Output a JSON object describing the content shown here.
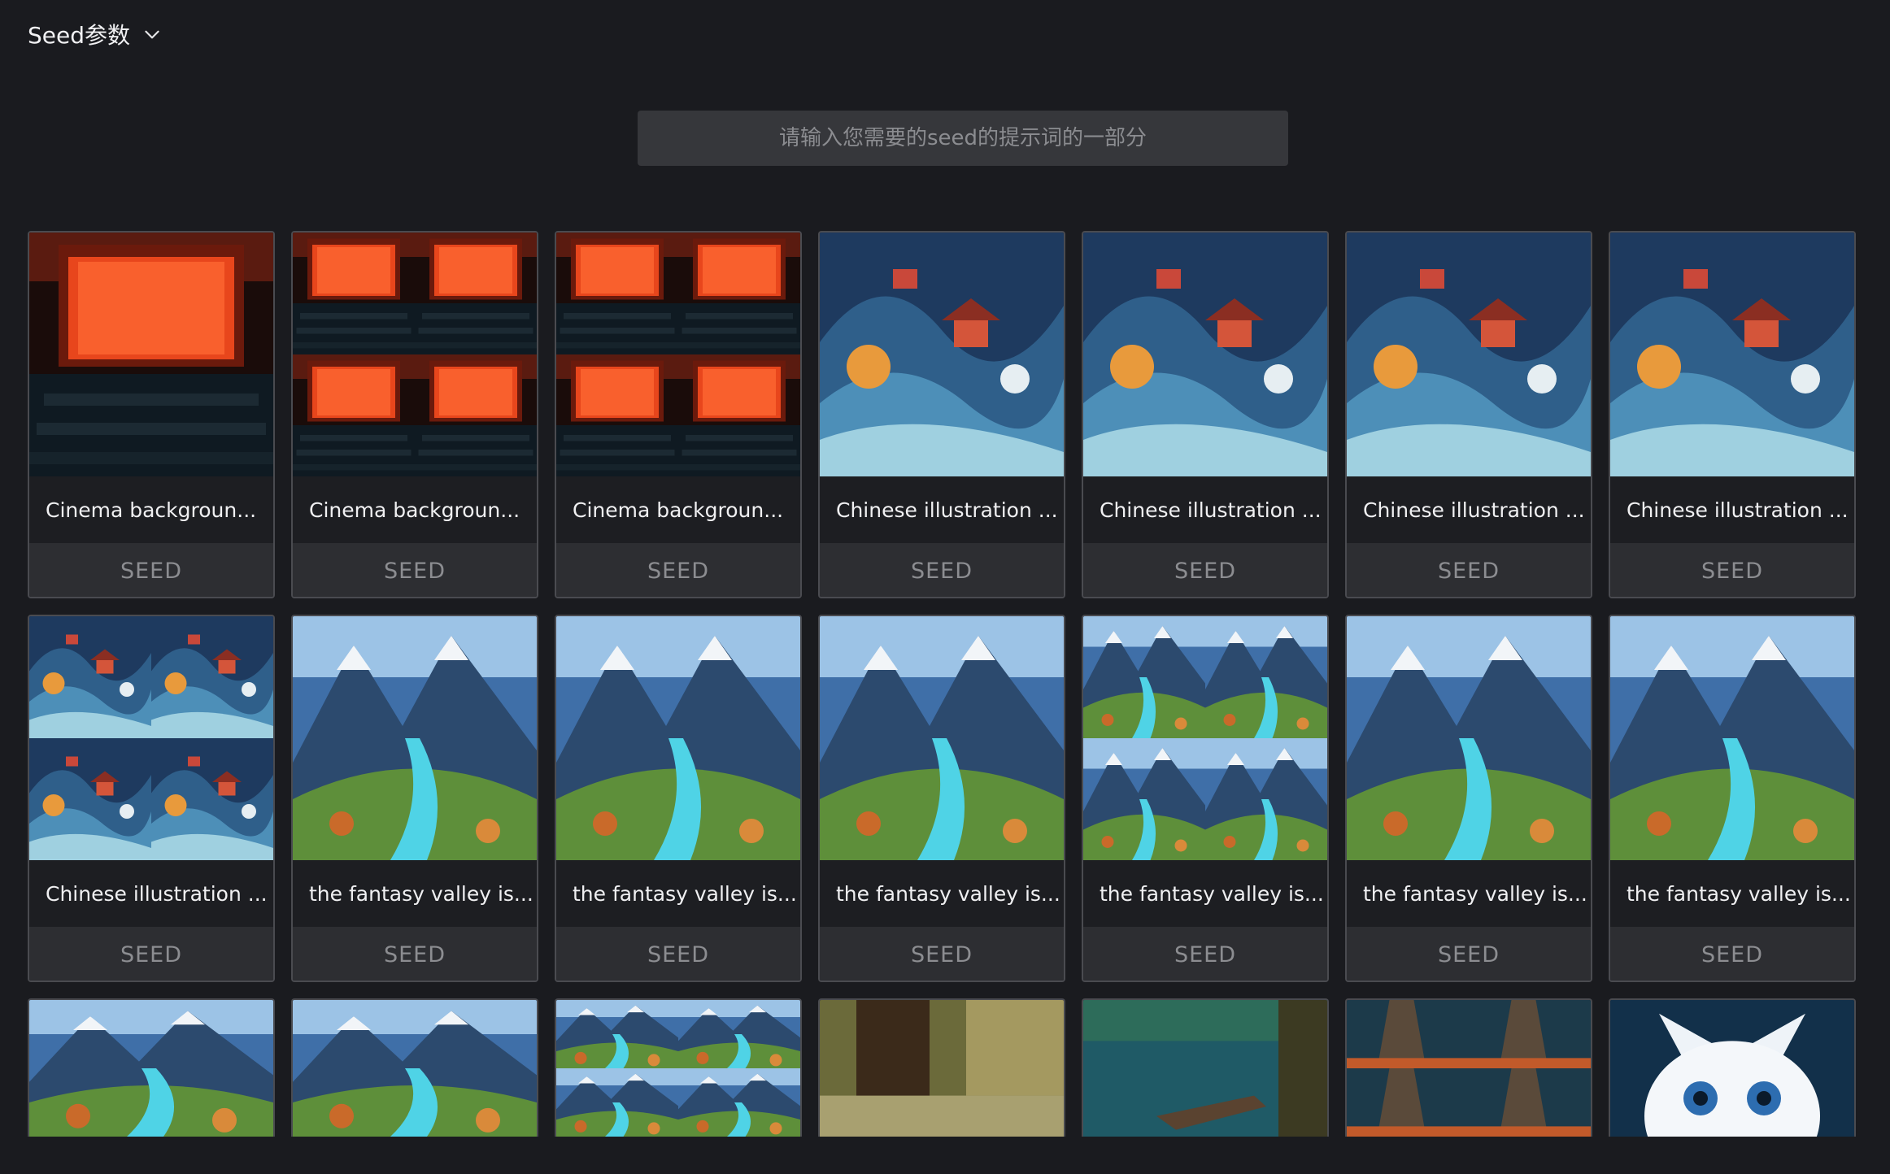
{
  "header": {
    "title": "Seed参数",
    "dropdown_icon": "chevron-down-icon"
  },
  "search": {
    "placeholder": "请输入您需要的seed的提示词的一部分",
    "value": ""
  },
  "seed_button_label": "SEED",
  "cards": [
    {
      "title": "Cinema backgroun...",
      "theme": "cinema",
      "layout": "single"
    },
    {
      "title": "Cinema backgroun...",
      "theme": "cinema",
      "layout": "quad"
    },
    {
      "title": "Cinema backgroun...",
      "theme": "cinema",
      "layout": "quad"
    },
    {
      "title": "Chinese illustration ...",
      "theme": "chinese",
      "layout": "single"
    },
    {
      "title": "Chinese illustration ...",
      "theme": "chinese",
      "layout": "single"
    },
    {
      "title": "Chinese illustration ...",
      "theme": "chinese",
      "layout": "single"
    },
    {
      "title": "Chinese illustration ...",
      "theme": "chinese",
      "layout": "single"
    },
    {
      "title": "Chinese illustration ...",
      "theme": "chinese",
      "layout": "quad"
    },
    {
      "title": "the fantasy valley is...",
      "theme": "valley",
      "layout": "single"
    },
    {
      "title": "the fantasy valley is...",
      "theme": "valley",
      "layout": "single"
    },
    {
      "title": "the fantasy valley is...",
      "theme": "valley",
      "layout": "single"
    },
    {
      "title": "the fantasy valley is...",
      "theme": "valley",
      "layout": "quad"
    },
    {
      "title": "the fantasy valley is...",
      "theme": "valley",
      "layout": "single"
    },
    {
      "title": "the fantasy valley is...",
      "theme": "valley",
      "layout": "single"
    }
  ],
  "partial_cards": [
    {
      "theme": "valley",
      "layout": "single"
    },
    {
      "theme": "valley",
      "layout": "single"
    },
    {
      "theme": "valley",
      "layout": "quad"
    },
    {
      "theme": "forest",
      "layout": "single"
    },
    {
      "theme": "lake",
      "layout": "single"
    },
    {
      "theme": "boardwalk",
      "layout": "quad"
    },
    {
      "theme": "cat",
      "layout": "single"
    }
  ],
  "colors": {
    "background": "#1a1b1f",
    "card_border": "#4a4b50",
    "seed_button_bg": "#2d2e32",
    "seed_button_text": "#8c8d91",
    "search_bg": "#36373b"
  }
}
